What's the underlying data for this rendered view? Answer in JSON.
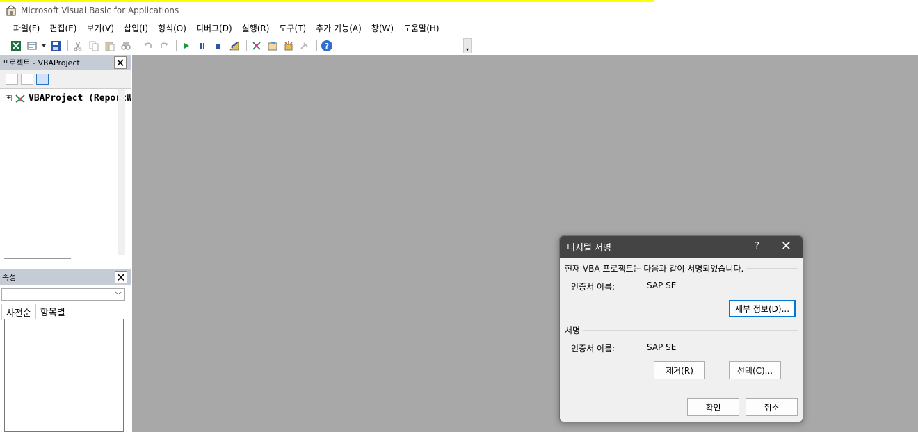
{
  "window": {
    "title": "Microsoft Visual Basic for Applications",
    "accent_color": "#ffff00"
  },
  "menu": {
    "items": [
      "파일(F)",
      "편집(E)",
      "보기(V)",
      "삽입(I)",
      "형식(O)",
      "디버그(D)",
      "실행(R)",
      "도구(T)",
      "추가 기능(A)",
      "창(W)",
      "도움말(H)"
    ]
  },
  "project_panel": {
    "title": "프로젝트 - VBAProject",
    "close": "✕",
    "tree_item": "VBAProject (Report₩",
    "expander": "+"
  },
  "properties_panel": {
    "title": "속성",
    "close": "✕",
    "tabs": [
      "사전순",
      "항목별"
    ]
  },
  "dialog": {
    "title": "디지털 서명",
    "help": "?",
    "close": "✕",
    "current_text": "현재 VBA 프로젝트는 다음과 같이 서명되었습니다.",
    "cert_label_1": "인증서 이름:",
    "cert_value_1": "SAP SE",
    "details_button": "세부 정보(D)...",
    "signature_group": "서명",
    "cert_label_2": "인증서 이름:",
    "cert_value_2": "SAP SE",
    "remove_button": "제거(R)",
    "choose_button": "선택(C)...",
    "ok_button": "확인",
    "cancel_button": "취소"
  },
  "colors": {
    "workspace": "#a8a8a8",
    "dialog_title_bg": "#444444",
    "panel_header": "#c5ccd6"
  }
}
